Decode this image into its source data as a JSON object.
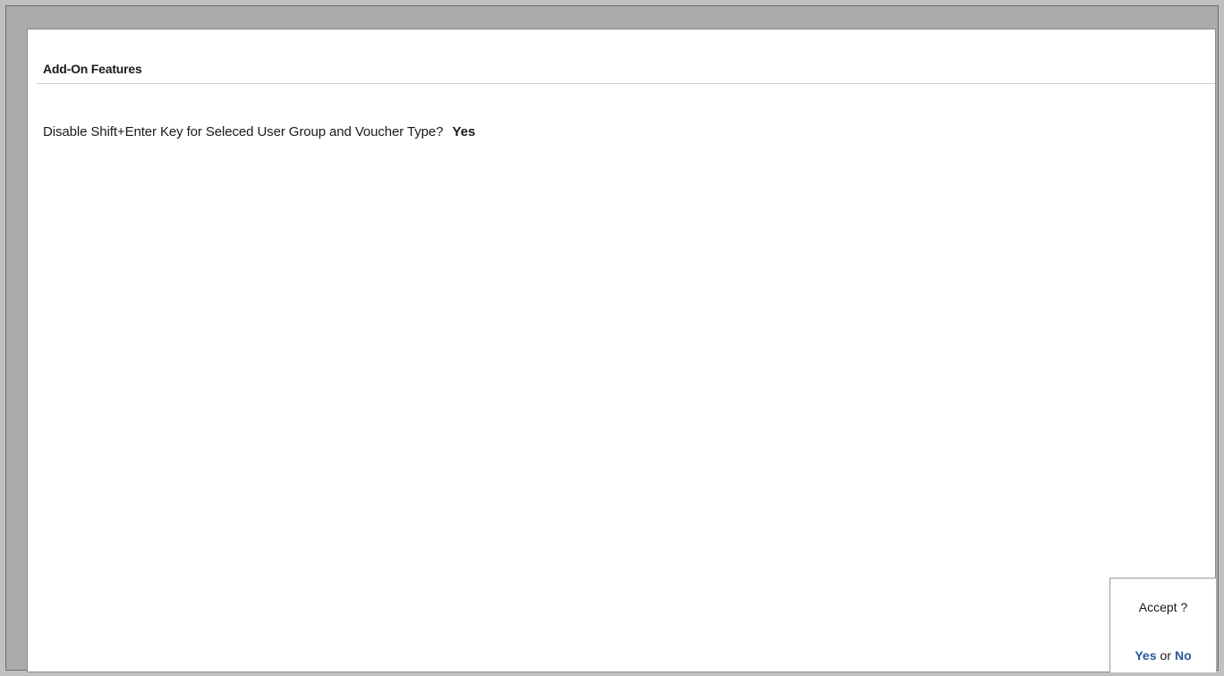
{
  "header": {
    "title": "Add-On Features"
  },
  "option": {
    "label": "Disable Shift+Enter Key for Seleced User Group and Voucher Type?",
    "value": "Yes"
  },
  "accept": {
    "question": "Accept ?",
    "yes_label": "Yes",
    "or_label": "or",
    "no_label": "No"
  },
  "colors": {
    "choice_accent": "#2a5a99",
    "frame": "#a9abad"
  }
}
